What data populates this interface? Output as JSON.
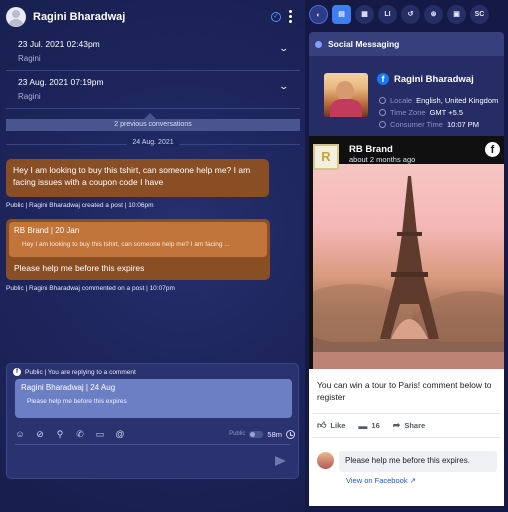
{
  "header": {
    "contact_name": "Ragini Bharadwaj"
  },
  "conversations": [
    {
      "date": "23 Jul. 2021 02:43pm",
      "user": "Ragini"
    },
    {
      "date": "23 Aug. 2021 07:19pm",
      "user": "Ragini"
    }
  ],
  "previous_label": "2 previous conversations",
  "date_divider": "24 Aug. 2021",
  "messages": {
    "first": "Hey I am looking to buy this tshirt, can someone help me? I am facing issues with a coupon code I have",
    "first_meta": "Public  |  Ragini Bharadwaj created a post  |  10:06pm",
    "reply_quote_title": "RB Brand | 20 Jan",
    "reply_quote_text": "Hey I am looking to buy this tshirt, can someone help me? I am facing ...",
    "reply_text": "Please help me before this expires",
    "reply_meta": "Public  |  Ragini Bharadwaj commented on a post  |  10:07pm"
  },
  "composer": {
    "context": "Public  |  You are replying to a comment",
    "quote_title": "Ragini Bharadwaj | 24 Aug",
    "quote_text": "Please help me before this expires",
    "toggle_label": "Public",
    "timer": "58m"
  },
  "toolbar": {
    "buttons": [
      "LI",
      "SC"
    ]
  },
  "social_panel": {
    "title": "Social Messaging",
    "profile_name": "Ragini Bharadwaj",
    "locale_label": "Locale",
    "locale_value": "English, United Kingdom",
    "tz_label": "Time Zone",
    "tz_value": "GMT +5.5",
    "time_label": "Consumer Time",
    "time_value": "10:07 PM"
  },
  "post": {
    "logo_letter": "R",
    "brand": "RB Brand",
    "time": "about 2 months ago",
    "text": "You can win a tour to Paris! comment below to register",
    "like_label": "Like",
    "comment_count": "16",
    "share_label": "Share",
    "comment_text": "Please help me before this expires.",
    "view_link": "View on Facebook"
  },
  "icons": [
    "check-circle-icon",
    "kebab-icon",
    "chevron-down-icon",
    "emoji-icon",
    "attachment-icon",
    "flow-icon",
    "phone-icon",
    "video-icon",
    "at-icon",
    "clock-icon",
    "send-icon",
    "facebook-icon",
    "like-icon",
    "comment-icon",
    "share-icon",
    "external-link-icon"
  ],
  "colors": {
    "accent": "#3f7ef0",
    "message_bubble": "#8a4e25",
    "quote": "#c1753a",
    "facebook": "#1877f2"
  }
}
